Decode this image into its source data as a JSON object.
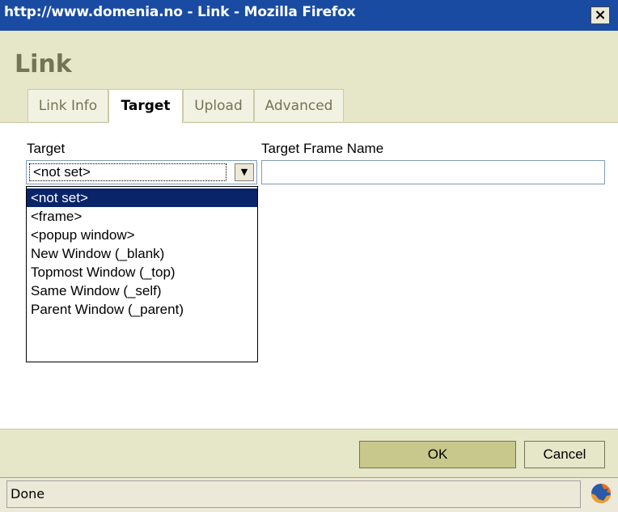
{
  "window": {
    "title": "http://www.domenia.no - Link - Mozilla Firefox",
    "close_label": "×"
  },
  "dialog": {
    "heading": "Link",
    "tabs": [
      {
        "label": "Link Info",
        "active": false
      },
      {
        "label": "Target",
        "active": true
      },
      {
        "label": "Upload",
        "active": false
      },
      {
        "label": "Advanced",
        "active": false
      }
    ]
  },
  "target": {
    "label": "Target",
    "selected": "<not set>",
    "options": [
      "<not set>",
      "<frame>",
      "<popup window>",
      "New Window (_blank)",
      "Topmost Window (_top)",
      "Same Window (_self)",
      "Parent Window (_parent)"
    ],
    "frame_name_label": "Target Frame Name",
    "frame_name_value": ""
  },
  "footer": {
    "ok_label": "OK",
    "cancel_label": "Cancel"
  },
  "statusbar": {
    "text": "Done",
    "icon": "firefox-icon"
  },
  "colors": {
    "titlebar": "#1a4ba3",
    "panel": "#e6e6c8",
    "heading": "#737357",
    "selection": "#0a246a"
  }
}
